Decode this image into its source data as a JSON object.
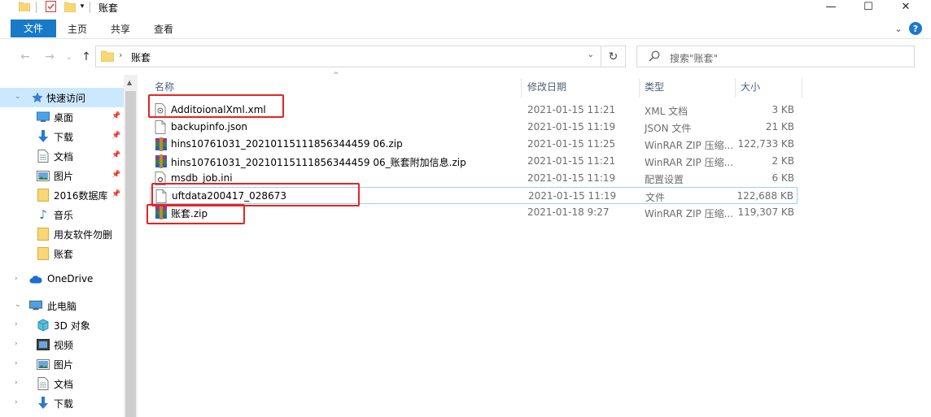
{
  "window": {
    "title": "账套"
  },
  "title_controls": {
    "minimize": "—",
    "maximize": "☐",
    "close": "✕"
  },
  "ribbon": {
    "tabs": [
      {
        "label": "文件",
        "active": true
      },
      {
        "label": "主页"
      },
      {
        "label": "共享"
      },
      {
        "label": "查看"
      }
    ],
    "collapse": "⌄",
    "help": "?"
  },
  "address": {
    "back": "←",
    "forward": "→",
    "recent": "⌄",
    "up": "↑",
    "separator": "›",
    "path": "账套",
    "dropdown": "⌄",
    "refresh": "↻"
  },
  "search": {
    "placeholder": "搜索\"账套\""
  },
  "sidebar": {
    "items": [
      {
        "label": "快速访问",
        "icon": "star-icon",
        "selected": true,
        "section": true
      },
      {
        "label": "桌面",
        "icon": "desktop-icon",
        "pinned": true
      },
      {
        "label": "下载",
        "icon": "download-icon",
        "pinned": true
      },
      {
        "label": "文档",
        "icon": "documents-icon",
        "pinned": true
      },
      {
        "label": "图片",
        "icon": "pictures-icon",
        "pinned": true
      },
      {
        "label": "2016数据库",
        "icon": "folder-icon",
        "pinned": true
      },
      {
        "label": "音乐",
        "icon": "music-icon"
      },
      {
        "label": "用友软件勿删",
        "icon": "folder-icon"
      },
      {
        "label": "账套",
        "icon": "folder-icon"
      },
      {
        "label": "OneDrive",
        "icon": "onedrive-icon",
        "section": true
      },
      {
        "label": "此电脑",
        "icon": "this-pc-icon",
        "section": true
      },
      {
        "label": "3D 对象",
        "icon": "3d-objects-icon"
      },
      {
        "label": "视频",
        "icon": "videos-icon"
      },
      {
        "label": "图片",
        "icon": "pictures-icon"
      },
      {
        "label": "文档",
        "icon": "documents-icon"
      },
      {
        "label": "下载",
        "icon": "download-icon"
      }
    ]
  },
  "columns": {
    "name": "名称",
    "date": "修改日期",
    "type": "类型",
    "size": "大小",
    "sort": "^"
  },
  "files": [
    {
      "name": "AdditoionalXml.xml",
      "date": "2021-01-15 11:21",
      "type": "XML 文档",
      "size": "3 KB",
      "icon": "xml-file-icon"
    },
    {
      "name": "backupinfo.json",
      "date": "2021-01-15 11:19",
      "type": "JSON 文件",
      "size": "21 KB",
      "icon": "json-file-icon"
    },
    {
      "name": "hins10761031_20210115111856344459 06.zip",
      "date": "2021-01-15 11:25",
      "type": "WinRAR ZIP 压缩...",
      "size": "122,733 KB",
      "icon": "winrar-zip-icon"
    },
    {
      "name": "hins10761031_20210115111856344459 06_账套附加信息.zip",
      "date": "2021-01-15 11:21",
      "type": "WinRAR ZIP 压缩...",
      "size": "2 KB",
      "icon": "winrar-zip-icon"
    },
    {
      "name": "msdb_job.ini",
      "date": "2021-01-15 11:19",
      "type": "配置设置",
      "size": "6 KB",
      "icon": "ini-file-icon"
    },
    {
      "name": "uftdata200417_028673",
      "date": "2021-01-15 11:19",
      "type": "文件",
      "size": "122,688 KB",
      "icon": "generic-file-icon",
      "selected": true
    },
    {
      "name": "账套.zip",
      "date": "2021-01-18 9:27",
      "type": "WinRAR ZIP 压缩...",
      "size": "119,307 KB",
      "icon": "winrar-zip-icon"
    }
  ],
  "colors": {
    "accent": "#1979ca",
    "highlight": "#e8231f",
    "selection": "#cce8ff",
    "folder": "#f8d775"
  }
}
